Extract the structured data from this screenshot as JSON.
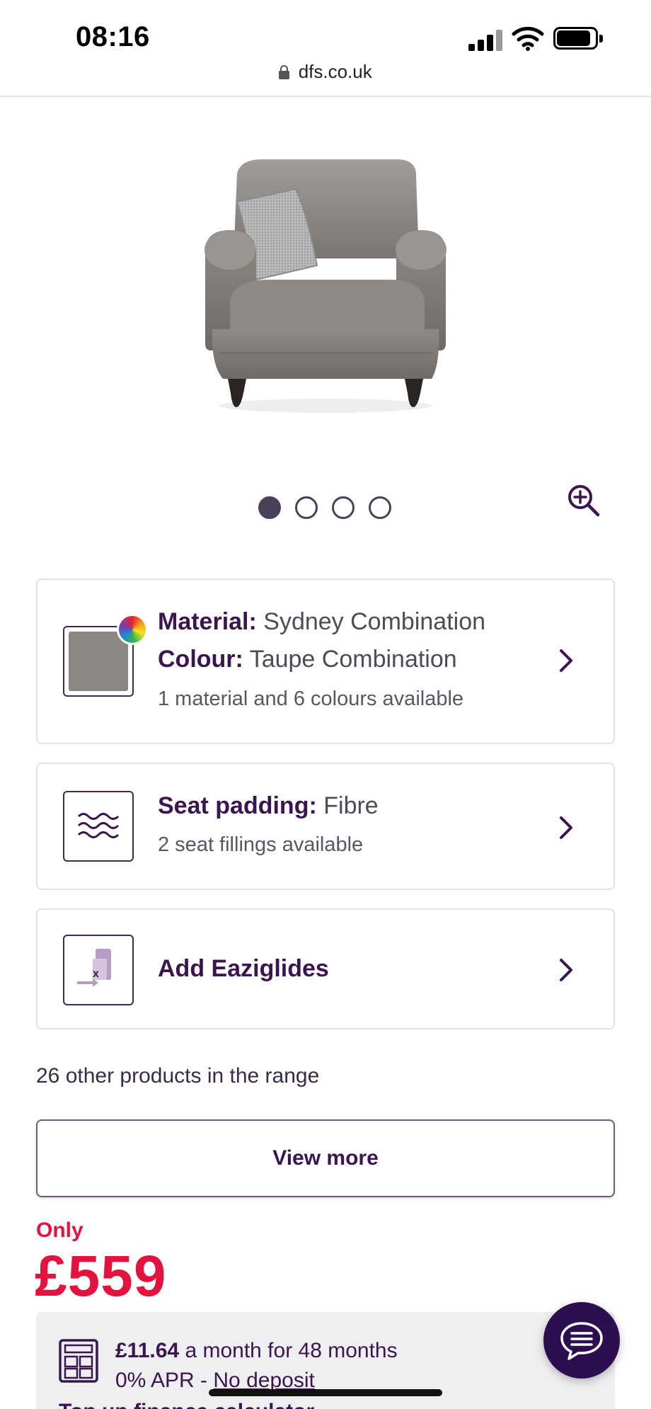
{
  "status_bar": {
    "time": "08:16"
  },
  "browser": {
    "url": "dfs.co.uk"
  },
  "product": {
    "image_alt": "Armchair",
    "carousel": {
      "total": 4,
      "active": 1
    }
  },
  "options": {
    "material": {
      "material_label": "Material:",
      "material_value": "Sydney Combination",
      "colour_label": "Colour:",
      "colour_value": "Taupe Combination",
      "availability": "1 material and 6 colours available",
      "swatch_color": "#8d8783"
    },
    "padding": {
      "label": "Seat padding:",
      "value": "Fibre",
      "availability": "2 seat fillings available"
    },
    "glides": {
      "label": "Add Eaziglides"
    }
  },
  "range": {
    "text": "26 other products in the range",
    "view_more_label": "View more"
  },
  "pricing": {
    "only_label": "Only",
    "price": "£559",
    "finance_amount": "£11.64",
    "finance_terms": "a month for 48 months",
    "apr": "0% APR - ",
    "deposit": "No deposit",
    "finance_more": "Top up finance calculator"
  },
  "colors": {
    "brand_purple": "#3a1550",
    "price_red": "#e2133f",
    "chat_bg": "#2b0f4f"
  }
}
